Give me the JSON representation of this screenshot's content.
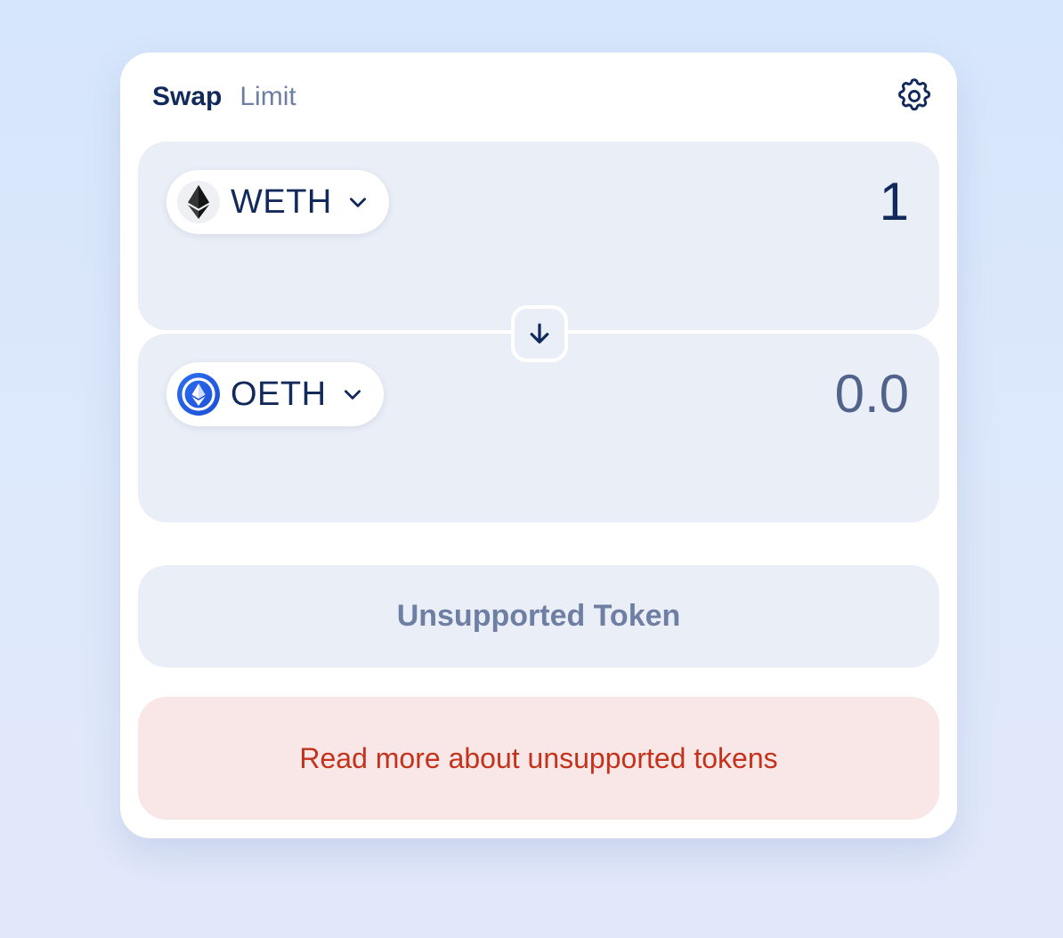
{
  "tabs": {
    "swap": "Swap",
    "limit": "Limit"
  },
  "input": {
    "token": "WETH",
    "amount": "1"
  },
  "output": {
    "token": "OETH",
    "amount": "0.0"
  },
  "action_button": "Unsupported Token",
  "warning_link": "Read more about unsupported tokens",
  "icons": {
    "settings": "gear-icon",
    "switch": "arrow-down-icon",
    "input_token": "weth-token-icon",
    "output_token": "oeth-token-icon",
    "dropdown": "chevron-down-icon"
  },
  "colors": {
    "primary_text": "#12295c",
    "muted_text": "#6e7fa3",
    "panel": "#eaeef7",
    "warning_bg": "#f8e7e6",
    "warning_text": "#c4321c",
    "oeth_blue": "#2f6ff0"
  }
}
